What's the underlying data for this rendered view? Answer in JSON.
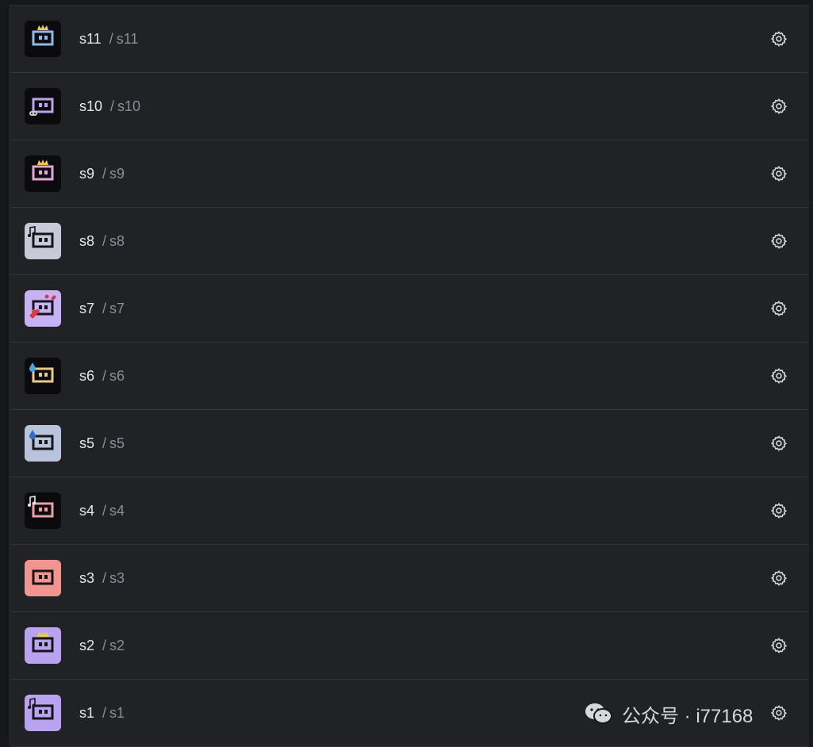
{
  "list": {
    "items": [
      {
        "name": "s11",
        "path": "s11",
        "avatar": {
          "bg": "#0b0b0d",
          "frame": "#8fb8e6",
          "accent": "crown",
          "accent_color": "#f2c94c"
        }
      },
      {
        "name": "s10",
        "path": "s10",
        "avatar": {
          "bg": "#0b0b0d",
          "frame": "#b9a4e8",
          "accent": "gamepad",
          "accent_color": "#c9c9d2"
        }
      },
      {
        "name": "s9",
        "path": "s9",
        "avatar": {
          "bg": "#0b0b0d",
          "frame": "#e6a3d8",
          "accent": "crown",
          "accent_color": "#f2c94c"
        }
      },
      {
        "name": "s8",
        "path": "s8",
        "avatar": {
          "bg": "#c5c9d8",
          "frame": "#15161a",
          "accent": "note",
          "accent_color": "#15161a"
        }
      },
      {
        "name": "s7",
        "path": "s7",
        "avatar": {
          "bg": "#c7b3f4",
          "frame": "#15161a",
          "accent": "hearts",
          "accent_color": "#d93a4a"
        }
      },
      {
        "name": "s6",
        "path": "s6",
        "avatar": {
          "bg": "#0b0b0d",
          "frame": "#e9c98a",
          "accent": "drop",
          "accent_color": "#4aa3e8"
        }
      },
      {
        "name": "s5",
        "path": "s5",
        "avatar": {
          "bg": "#b9c4dc",
          "frame": "#15161a",
          "accent": "drop",
          "accent_color": "#2f6fc7"
        }
      },
      {
        "name": "s4",
        "path": "s4",
        "avatar": {
          "bg": "#0b0b0d",
          "frame": "#e8a0a8",
          "accent": "note",
          "accent_color": "#e6e6ea"
        }
      },
      {
        "name": "s3",
        "path": "s3",
        "avatar": {
          "bg": "#f3958f",
          "frame": "#15161a",
          "accent": "none",
          "accent_color": "#15161a"
        }
      },
      {
        "name": "s2",
        "path": "s2",
        "avatar": {
          "bg": "#b9a3f0",
          "frame": "#15161a",
          "accent": "crown",
          "accent_color": "#f2c94c"
        }
      },
      {
        "name": "s1",
        "path": "s1",
        "avatar": {
          "bg": "#b9a3f0",
          "frame": "#15161a",
          "accent": "note",
          "accent_color": "#15161a"
        }
      }
    ],
    "separator": "/",
    "action_icon": "gear-icon"
  },
  "watermark": {
    "text": "公众号 · i77168",
    "icon": "wechat-icon"
  }
}
